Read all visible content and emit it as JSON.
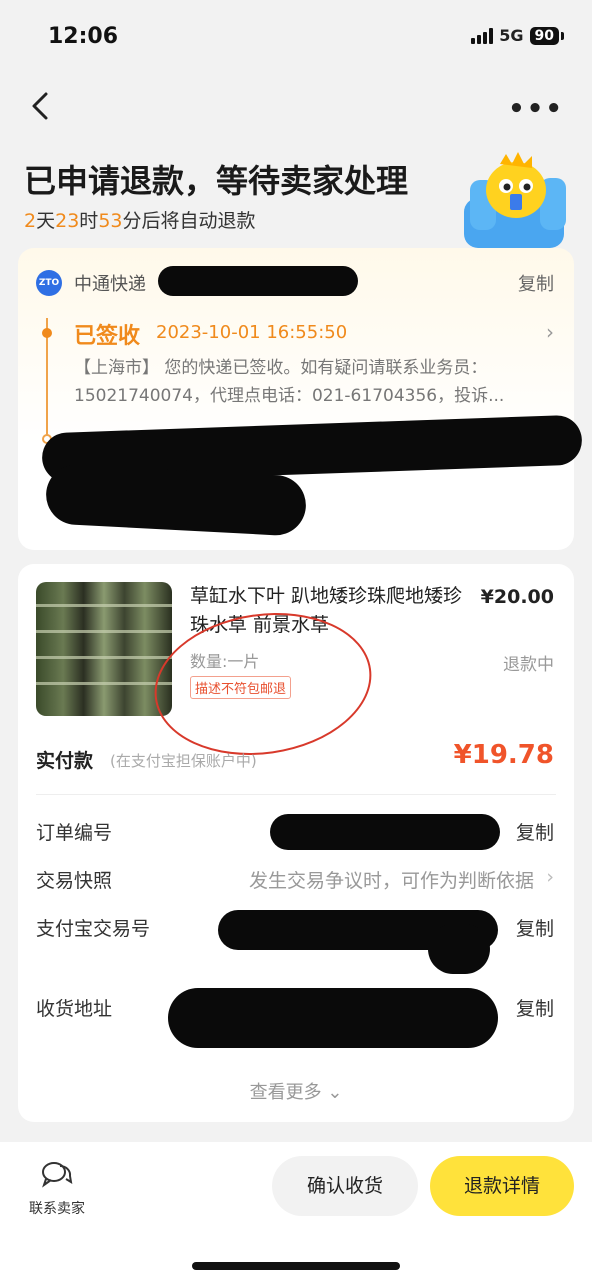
{
  "status_bar": {
    "time": "12:06",
    "network": "5G",
    "battery": "90"
  },
  "header": {
    "title": "已申请退款，等待卖家处理",
    "countdown": {
      "days": "2",
      "days_unit": "天",
      "hours": "23",
      "hours_unit": "时",
      "minutes": "53",
      "suffix": "分后将自动退款"
    }
  },
  "logistics": {
    "carrier": "中通快递",
    "logo_text": "ZTO",
    "copy_label": "复制",
    "status": "已签收",
    "time": "2023-10-01 16:55:50",
    "detail": "【上海市】 您的快递已签收。如有疑问请联系业务员：15021740074，代理点电话：021-61704356，投诉..."
  },
  "product": {
    "title": "草缸水下叶 趴地矮珍珠爬地矮珍珠水草 前景水草",
    "price": "¥20.00",
    "quantity": "数量:一片",
    "status": "退款中",
    "badge": "描述不符包邮退"
  },
  "payment": {
    "label": "实付款",
    "note": "(在支付宝担保账户中)",
    "amount": "¥19.78"
  },
  "details": [
    {
      "label": "订单编号",
      "action": "复制"
    },
    {
      "label": "交易快照",
      "value": "发生交易争议时，可作为判断依据"
    },
    {
      "label": "支付宝交易号",
      "action": "复制"
    },
    {
      "label": "收货地址",
      "action": "复制"
    }
  ],
  "see_more": "查看更多",
  "bottom_bar": {
    "contact": "联系卖家",
    "confirm": "确认收货",
    "refund_detail": "退款详情"
  }
}
